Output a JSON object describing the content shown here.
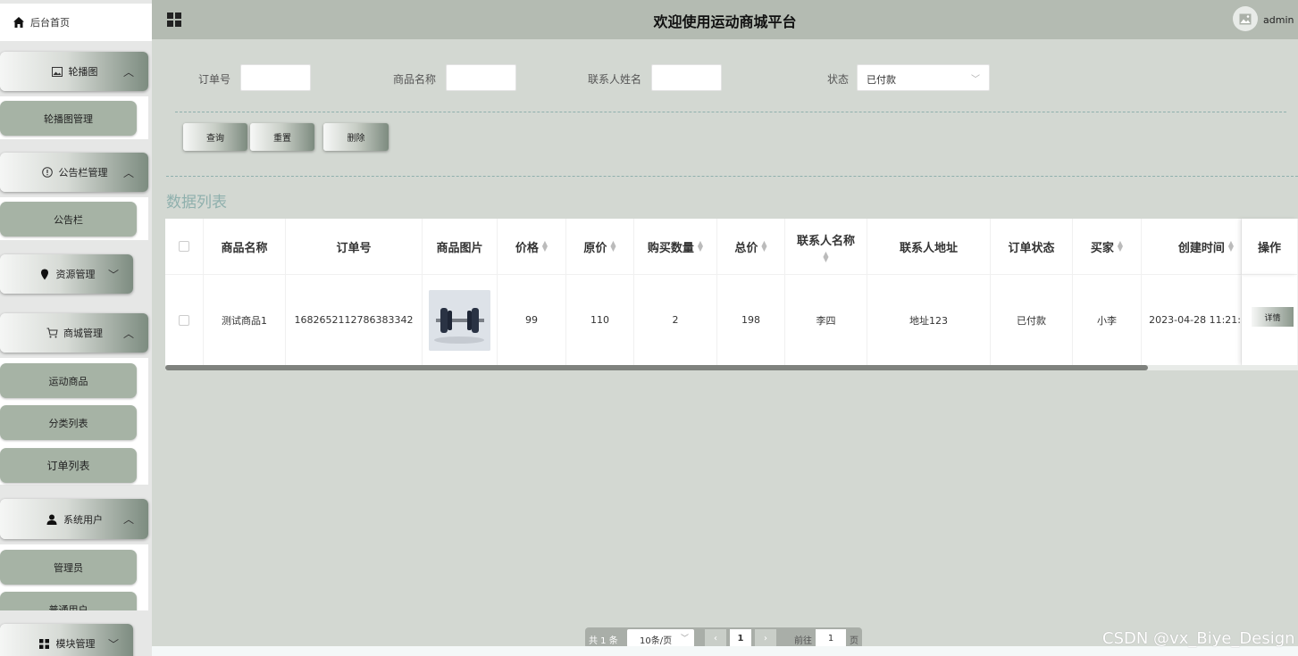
{
  "header": {
    "title": "欢迎使用运动商城平台",
    "username": "admin"
  },
  "sidebar": {
    "home": "后台首页",
    "groups": [
      {
        "label": "轮播图",
        "icon": "image-icon",
        "items": [
          "轮播图管理"
        ]
      },
      {
        "label": "公告栏管理",
        "icon": "info-icon",
        "items": [
          "公告栏"
        ]
      },
      {
        "label": "资源管理",
        "icon": "location-icon",
        "items": []
      },
      {
        "label": "商城管理",
        "icon": "cart-icon",
        "items": [
          "运动商品",
          "分类列表",
          "订单列表"
        ]
      },
      {
        "label": "系统用户",
        "icon": "user-icon",
        "items": [
          "管理员",
          "普通用户"
        ]
      },
      {
        "label": "模块管理",
        "icon": "grid-icon",
        "items": []
      }
    ]
  },
  "search": {
    "order_no_label": "订单号",
    "product_name_label": "商品名称",
    "contact_name_label": "联系人姓名",
    "status_label": "状态",
    "status_value": "已付款",
    "query_button": "查询",
    "reset_button": "重置",
    "delete_button": "删除"
  },
  "section_title": "数据列表",
  "table": {
    "headers": [
      "商品名称",
      "订单号",
      "商品图片",
      "价格",
      "原价",
      "购买数量",
      "总价",
      "联系人名称",
      "联系人地址",
      "订单状态",
      "买家",
      "创建时间",
      "操作"
    ],
    "rows": [
      {
        "product_name": "测试商品1",
        "order_no": "1682652112786383342",
        "price": "99",
        "original_price": "110",
        "quantity": "2",
        "total": "198",
        "contact_name": "李四",
        "contact_address": "地址123",
        "status": "已付款",
        "buyer": "小李",
        "created": "2023-04-28 11:21:",
        "action": "详情"
      }
    ]
  },
  "pagination": {
    "total": "共 1 条",
    "page_size": "10条/页",
    "current": "1",
    "goto_label": "前往",
    "goto_value": "1",
    "page_word": "页"
  },
  "watermark": "CSDN @vx_Biye_Design"
}
